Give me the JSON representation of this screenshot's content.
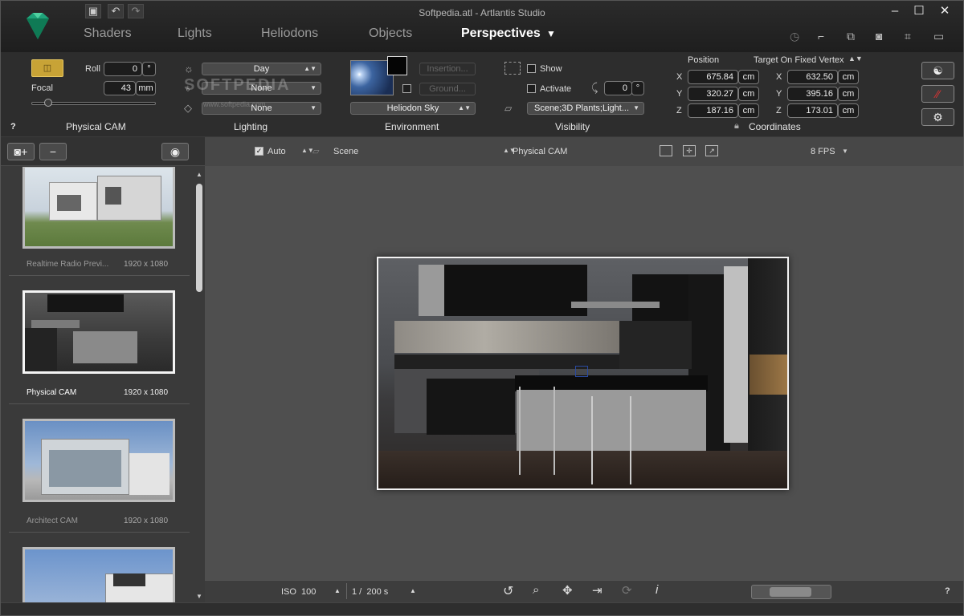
{
  "window": {
    "title": "Softpedia.atl - Artlantis Studio"
  },
  "tabs": [
    "Shaders",
    "Lights",
    "Heliodons",
    "Objects",
    "Perspectives"
  ],
  "active_tab": "Perspectives",
  "camera": {
    "roll_label": "Roll",
    "roll_value": "0",
    "roll_unit": "°",
    "focal_label": "Focal",
    "focal_value": "43",
    "focal_unit": "mm",
    "section": "Physical CAM"
  },
  "lighting": {
    "day": "Day",
    "opt2": "None",
    "opt3": "None",
    "section": "Lighting"
  },
  "environment": {
    "insertion": "Insertion...",
    "ground": "Ground...",
    "sky": "Heliodon Sky",
    "section": "Environment"
  },
  "visibility": {
    "show": "Show",
    "activate": "Activate",
    "angle_value": "0",
    "angle_unit": "°",
    "scene_select": "Scene;3D Plants;Light...",
    "section": "Visibility"
  },
  "coordinates": {
    "position_label": "Position",
    "target_label": "Target On Fixed Vertex",
    "section": "Coordinates",
    "unit": "cm",
    "position": [
      {
        "axis": "X",
        "value": "675.84"
      },
      {
        "axis": "Y",
        "value": "320.27"
      },
      {
        "axis": "Z",
        "value": "187.16"
      }
    ],
    "target": [
      {
        "axis": "X",
        "value": "632.50"
      },
      {
        "axis": "Y",
        "value": "395.16"
      },
      {
        "axis": "Z",
        "value": "173.01"
      }
    ]
  },
  "help": "?",
  "watermark": {
    "brand": "SOFTPEDIA",
    "url": "www.softpedia.com"
  },
  "sidebar": {
    "items": [
      {
        "name": "Realtime Radio Previ...",
        "size": "1920 x 1080"
      },
      {
        "name": "Physical CAM",
        "size": "1920 x 1080"
      },
      {
        "name": "Architect CAM",
        "size": "1920 x 1080"
      }
    ]
  },
  "viewport": {
    "auto_label": "Auto",
    "scene_label": "Scene",
    "camera_label": "Physical CAM",
    "fps": "8 FPS"
  },
  "footer": {
    "iso_label": "ISO",
    "iso_value": "100",
    "shutter": "1 /  200 s",
    "help": "?"
  },
  "colors": {
    "accent": "#1fa37a",
    "camera_btn": "#c8a336",
    "bg": "#232323"
  },
  "icons": [
    "save-icon",
    "undo-icon",
    "redo-icon",
    "timer-icon",
    "crop-icon",
    "copy-icon",
    "camera-icon",
    "frame-icon",
    "window-icon",
    "gear-icon",
    "eye-icon",
    "refresh-icon",
    "zoom-icon",
    "move-icon",
    "exit-icon",
    "info-icon"
  ]
}
